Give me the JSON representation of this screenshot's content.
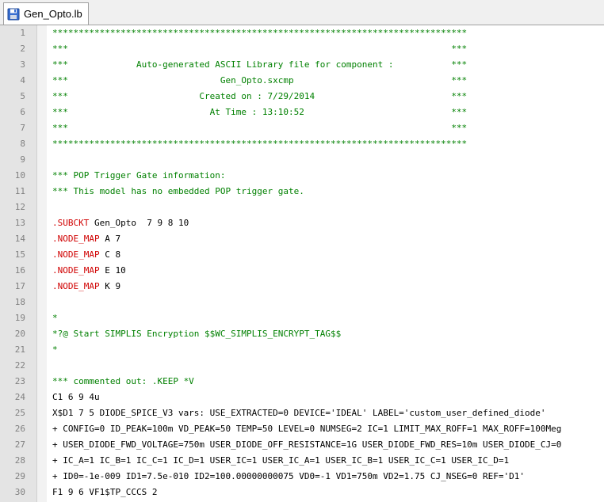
{
  "tab": {
    "label": "Gen_Opto.lb",
    "icon": "save-document-icon"
  },
  "lines": [
    {
      "n": "1",
      "text": "*******************************************************************************",
      "cls": "c-comment"
    },
    {
      "n": "2",
      "text": "***                                                                         ***",
      "cls": "c-comment"
    },
    {
      "n": "3",
      "text": "***             Auto-generated ASCII Library file for component :           ***",
      "cls": "c-comment"
    },
    {
      "n": "4",
      "text": "***                             Gen_Opto.sxcmp                              ***",
      "cls": "c-comment"
    },
    {
      "n": "5",
      "text": "***                         Created on : 7/29/2014                          ***",
      "cls": "c-comment"
    },
    {
      "n": "6",
      "text": "***                           At Time : 13:10:52                            ***",
      "cls": "c-comment"
    },
    {
      "n": "7",
      "text": "***                                                                         ***",
      "cls": "c-comment"
    },
    {
      "n": "8",
      "text": "*******************************************************************************",
      "cls": "c-comment"
    },
    {
      "n": "9",
      "text": "",
      "cls": "c-def"
    },
    {
      "n": "10",
      "text": "*** POP Trigger Gate information:",
      "cls": "c-comment"
    },
    {
      "n": "11",
      "text": "*** This model has no embedded POP trigger gate.",
      "cls": "c-comment"
    },
    {
      "n": "12",
      "text": "",
      "cls": "c-def"
    },
    {
      "n": "13",
      "kw": ".SUBCKT",
      "text": " Gen_Opto  7 9 8 10",
      "cls": "c-def"
    },
    {
      "n": "14",
      "kw": ".NODE_MAP",
      "text": " A 7",
      "cls": "c-def"
    },
    {
      "n": "15",
      "kw": ".NODE_MAP",
      "text": " C 8",
      "cls": "c-def"
    },
    {
      "n": "16",
      "kw": ".NODE_MAP",
      "text": " E 10",
      "cls": "c-def"
    },
    {
      "n": "17",
      "kw": ".NODE_MAP",
      "text": " K 9",
      "cls": "c-def"
    },
    {
      "n": "18",
      "text": "",
      "cls": "c-def"
    },
    {
      "n": "19",
      "text": "*",
      "cls": "c-comment"
    },
    {
      "n": "20",
      "text": "*?@ Start SIMPLIS Encryption $$WC_SIMPLIS_ENCRYPT_TAG$$",
      "cls": "c-comment"
    },
    {
      "n": "21",
      "text": "*",
      "cls": "c-comment"
    },
    {
      "n": "22",
      "text": "",
      "cls": "c-def"
    },
    {
      "n": "23",
      "text": "*** commented out: .KEEP *V",
      "cls": "c-comment"
    },
    {
      "n": "24",
      "text": "C1 6 9 4u",
      "cls": "c-def"
    },
    {
      "n": "25",
      "text": "X$D1 7 5 DIODE_SPICE_V3 vars: USE_EXTRACTED=0 DEVICE='IDEAL' LABEL='custom_user_defined_diode'",
      "cls": "c-def"
    },
    {
      "n": "26",
      "text": "+ CONFIG=0 ID_PEAK=100m VD_PEAK=50 TEMP=50 LEVEL=0 NUMSEG=2 IC=1 LIMIT_MAX_ROFF=1 MAX_ROFF=100Meg",
      "cls": "c-def"
    },
    {
      "n": "27",
      "text": "+ USER_DIODE_FWD_VOLTAGE=750m USER_DIODE_OFF_RESISTANCE=1G USER_DIODE_FWD_RES=10m USER_DIODE_CJ=0",
      "cls": "c-def"
    },
    {
      "n": "28",
      "text": "+ IC_A=1 IC_B=1 IC_C=1 IC_D=1 USER_IC=1 USER_IC_A=1 USER_IC_B=1 USER_IC_C=1 USER_IC_D=1",
      "cls": "c-def"
    },
    {
      "n": "29",
      "text": "+ ID0=-1e-009 ID1=7.5e-010 ID2=100.00000000075 VD0=-1 VD1=750m VD2=1.75 CJ_NSEG=0 REF='D1'",
      "cls": "c-def"
    },
    {
      "n": "30",
      "text": "F1 9 6 VF1$TP_CCCS 2",
      "cls": "c-def"
    }
  ]
}
